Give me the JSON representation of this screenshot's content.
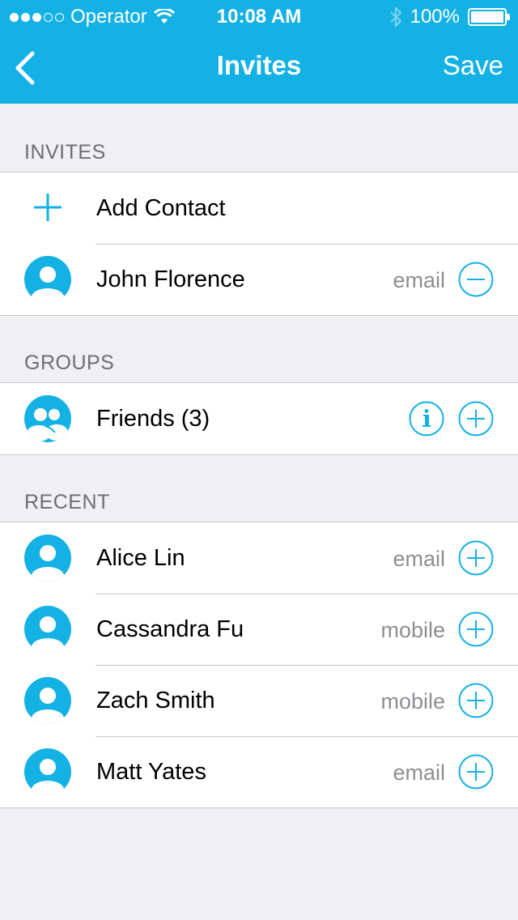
{
  "status_bar": {
    "carrier": "Operator",
    "time": "10:08 AM",
    "battery": "100%",
    "signal_filled": 3,
    "signal_total": 5
  },
  "nav": {
    "title": "Invites",
    "save_label": "Save",
    "back_icon": "chevron-left-icon"
  },
  "colors": {
    "accent": "#14b1e4",
    "background": "#efeff4",
    "secondary_text": "#8e8e93",
    "section_header": "#6d6d72"
  },
  "sections": {
    "invites": {
      "header": "INVITES",
      "add_contact_label": "Add Contact",
      "items": [
        {
          "name": "John Florence",
          "type": "email",
          "action": "remove"
        }
      ]
    },
    "groups": {
      "header": "GROUPS",
      "items": [
        {
          "name": "Friends (3)",
          "action": "add",
          "info": true
        }
      ]
    },
    "recent": {
      "header": "RECENT",
      "items": [
        {
          "name": "Alice Lin",
          "type": "email",
          "action": "add"
        },
        {
          "name": "Cassandra Fu",
          "type": "mobile",
          "action": "add"
        },
        {
          "name": "Zach Smith",
          "type": "mobile",
          "action": "add"
        },
        {
          "name": "Matt Yates",
          "type": "email",
          "action": "add"
        }
      ]
    }
  }
}
